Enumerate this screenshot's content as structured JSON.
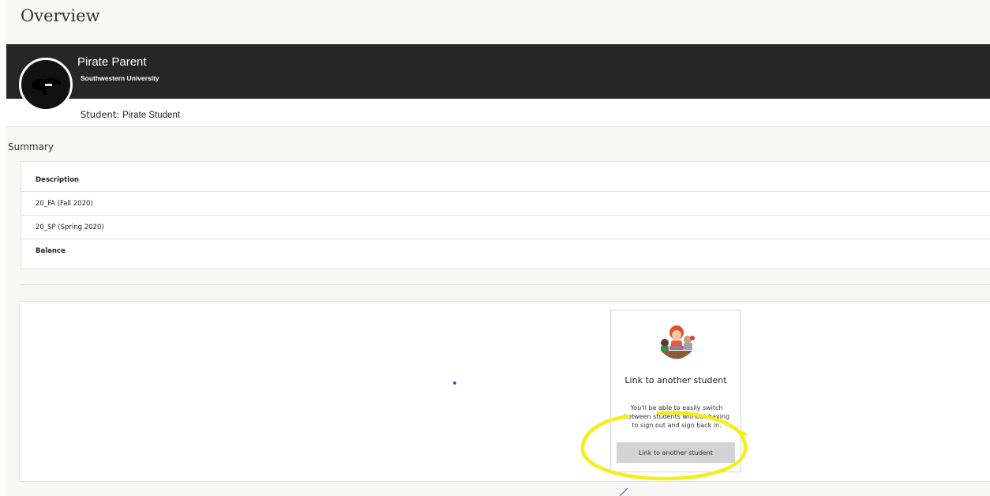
{
  "page": {
    "title": "Overview"
  },
  "user": {
    "name": "Pirate Parent",
    "school": "Southwestern University"
  },
  "student": {
    "label": "Student:",
    "value": "Pirate Student"
  },
  "summary": {
    "heading": "Summary",
    "rows": [
      "Description",
      "20_FA (Fall 2020)",
      "20_SP (Spring 2020)",
      "Balance"
    ]
  },
  "link_card": {
    "title": "Link to another student",
    "text": "You'll be able to easily switch between students without having to sign out and sign back in.",
    "button_label": "Link to another student"
  },
  "colors": {
    "banner": "#262626",
    "highlight": "#f2ef1a",
    "button": "#d3d3d3"
  },
  "icons": {
    "avatar": "pirate-silhouette-icon",
    "illustration": "students-group-illustration"
  }
}
